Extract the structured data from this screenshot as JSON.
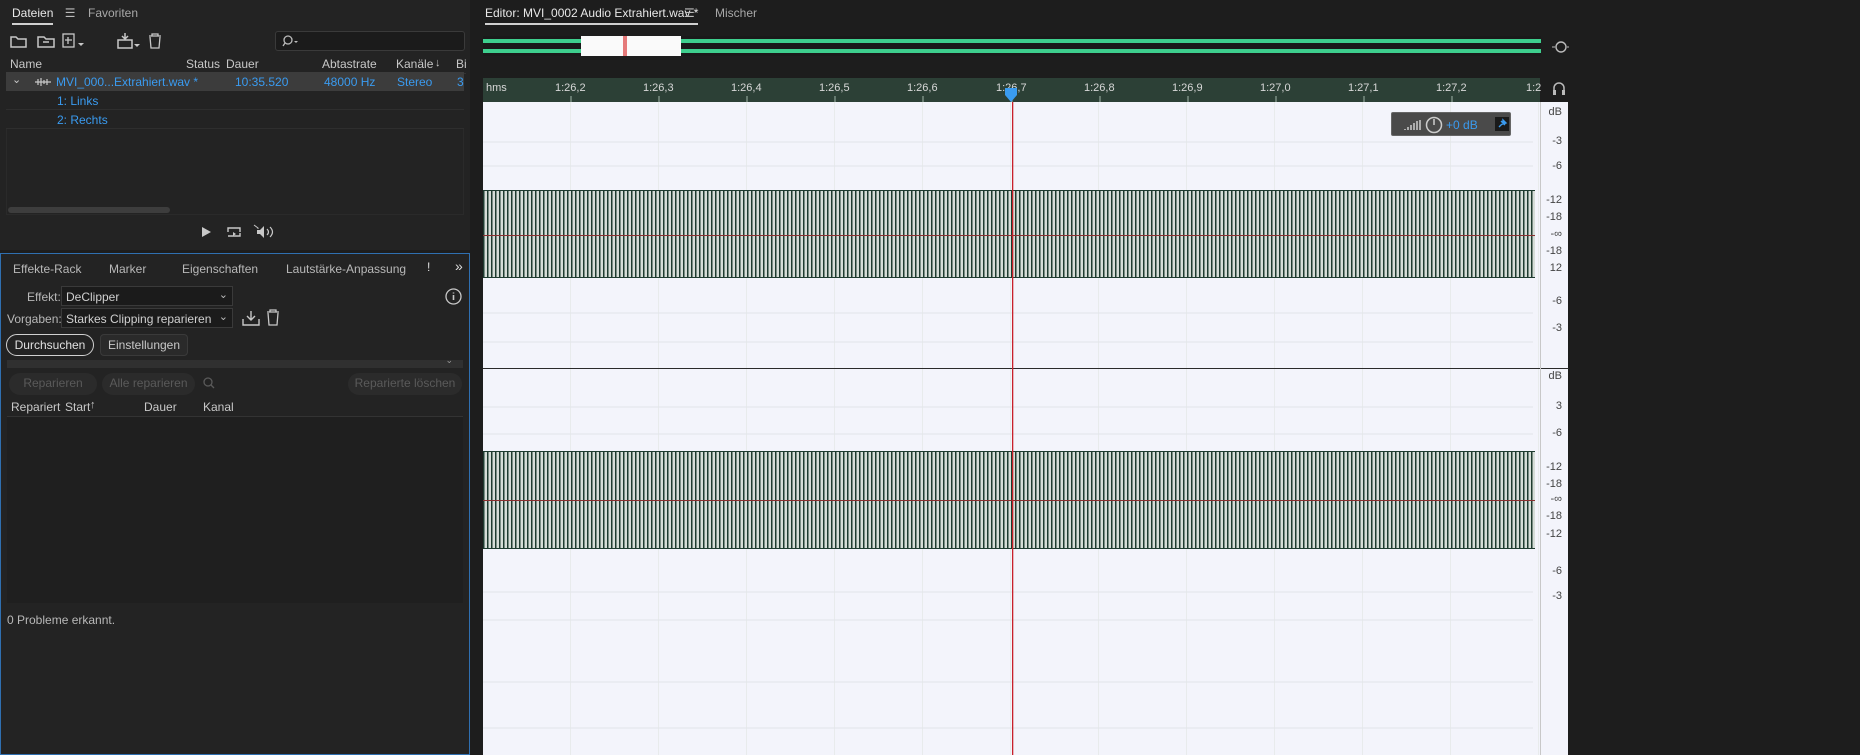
{
  "files_panel": {
    "tabs": [
      {
        "label": "Dateien"
      },
      {
        "label": "Favoriten"
      }
    ],
    "search_placeholder": "",
    "columns": {
      "name": "Name",
      "status": "Status",
      "duration": "Dauer",
      "samplerate": "Abtastrate",
      "channels": "Kanäle",
      "bit": "Bi"
    },
    "file": {
      "name": "MVI_000...Extrahiert.wav *",
      "duration": "10:35.520",
      "samplerate": "48000 Hz",
      "channels": "Stereo",
      "bit": "3"
    },
    "channel_rows": [
      {
        "label": "1: Links"
      },
      {
        "label": "2: Rechts"
      }
    ]
  },
  "effects_panel": {
    "tabs": [
      {
        "label": "Effekte-Rack"
      },
      {
        "label": "Marker"
      },
      {
        "label": "Eigenschaften"
      },
      {
        "label": "Lautstärke-Anpassung"
      }
    ],
    "effect_label": "Effekt:",
    "effect_value": "DeClipper",
    "preset_label": "Vorgaben:",
    "preset_value": "Starkes Clipping reparieren",
    "scan_button": "Durchsuchen",
    "settings_button": "Einstellungen",
    "repair_button": "Reparieren",
    "repair_all_button": "Alle reparieren",
    "delete_repaired_button": "Reparierte löschen",
    "table_columns": {
      "repaired": "Repariert",
      "start": "Start",
      "duration": "Dauer",
      "channel": "Kanal"
    },
    "status": "0 Probleme erkannt."
  },
  "editor": {
    "tab_label": "Editor: MVI_0002 Audio Extrahiert.wav *",
    "mixer_tab": "Mischer",
    "ruler_unit": "hms",
    "ruler_ticks": [
      "1:26,2",
      "1:26,3",
      "1:26,4",
      "1:26,5",
      "1:26,6",
      "1:26,7",
      "1:26,8",
      "1:26,9",
      "1:27,0",
      "1:27,1",
      "1:27,2",
      "1:2"
    ],
    "hud_gain": "+0 dB",
    "db_top": [
      "dB",
      "-3",
      "-6",
      "-12",
      "-18",
      "-∞",
      "-18",
      "12",
      "-6",
      "-3"
    ],
    "db_bottom": [
      "dB",
      "3",
      "-6",
      "-12",
      "-18",
      "-∞",
      "-18",
      "-12",
      "-6",
      "-3"
    ],
    "colors": {
      "waveform": "#1e3b30",
      "playhead": "#c8202a",
      "overview": "#3ecf8e",
      "background": "#f3f4fb",
      "accent": "#3a9bf0"
    }
  }
}
